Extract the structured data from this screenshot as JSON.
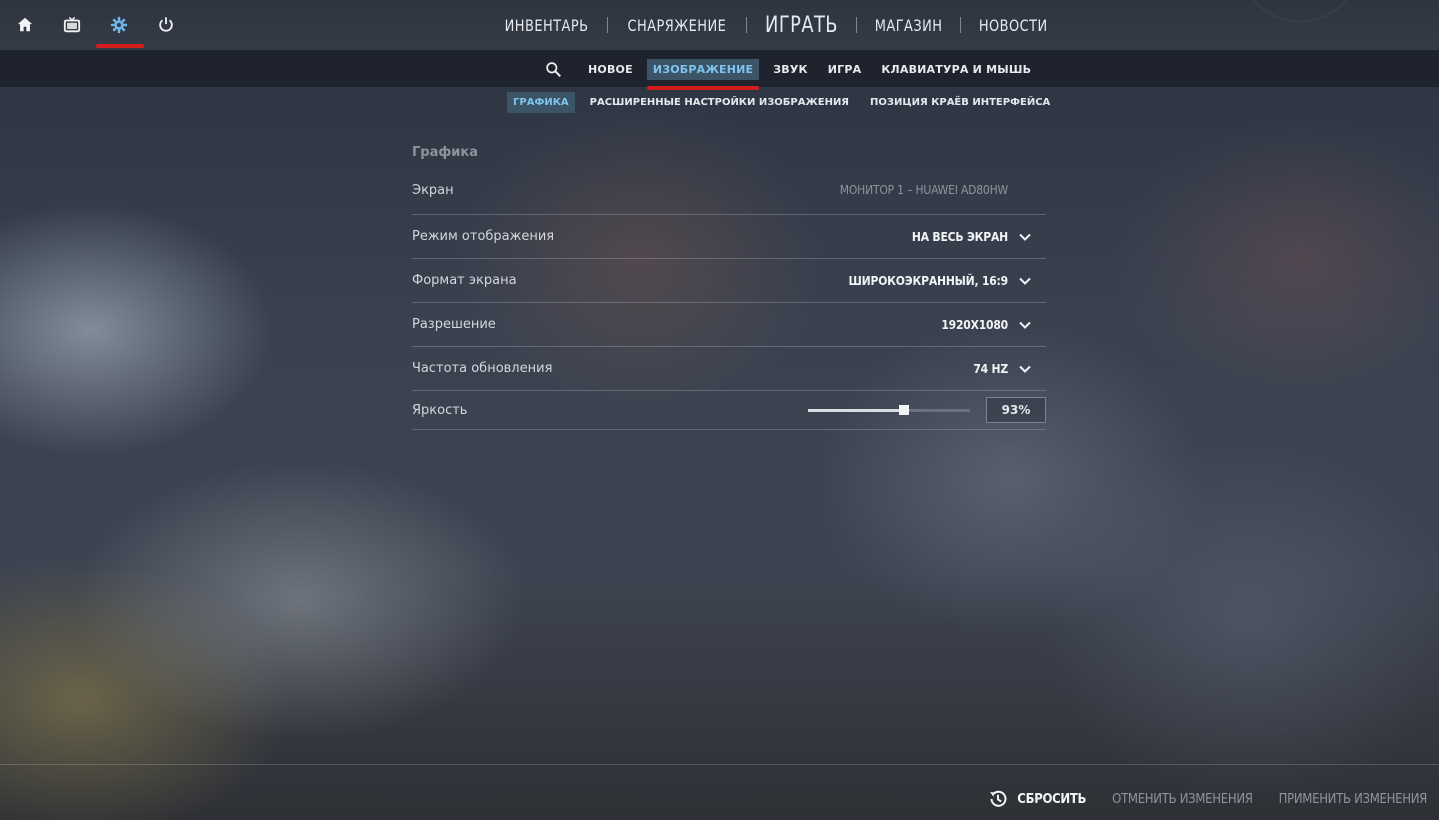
{
  "system_icons": [
    {
      "name": "home-icon"
    },
    {
      "name": "tv-icon"
    },
    {
      "name": "gear-icon",
      "active": true
    },
    {
      "name": "power-icon"
    }
  ],
  "main_nav": {
    "inventory": "Инвентарь",
    "loadout": "Снаряжение",
    "play": "Играть",
    "store": "Магазин",
    "news": "Новости"
  },
  "settings_tabs": {
    "new": "Новое",
    "video": "Изображение",
    "audio": "Звук",
    "game": "Игра",
    "keyboard_mouse": "Клавиатура и мышь",
    "active": "Изображение"
  },
  "video_subtabs": {
    "graphics": "Графика",
    "advanced": "Расширенные настройки изображения",
    "hud_edge": "Позиция краёв интерфейса",
    "active": "Графика"
  },
  "graphics": {
    "section_title": "Графика",
    "screen": {
      "label": "Экран",
      "value": "Монитор 1 – HUAWEI AD80HW"
    },
    "display_mode": {
      "label": "Режим отображения",
      "value": "На весь экран"
    },
    "aspect_ratio": {
      "label": "Формат экрана",
      "value": "Широкоэкранный, 16:9"
    },
    "resolution": {
      "label": "Разрешение",
      "value": "1920x1080"
    },
    "refresh_rate": {
      "label": "Частота обновления",
      "value": "74 Hz"
    },
    "brightness": {
      "label": "Яркость",
      "value_text": "93%",
      "slider_fraction": 0.59
    }
  },
  "footer": {
    "reset": "Сбросить",
    "discard": "Отменить изменения",
    "apply": "Применить изменения"
  },
  "colors": {
    "accent_red": "#d41e1e",
    "active_tab_bg": "#3c5566",
    "active_tab_text": "#7fc4ee"
  }
}
